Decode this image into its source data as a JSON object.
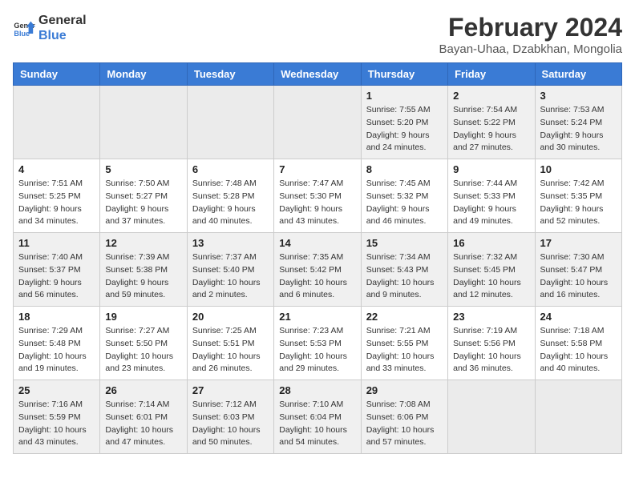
{
  "header": {
    "logo_line1": "General",
    "logo_line2": "Blue",
    "month_year": "February 2024",
    "location": "Bayan-Uhaa, Dzabkhan, Mongolia"
  },
  "weekdays": [
    "Sunday",
    "Monday",
    "Tuesday",
    "Wednesday",
    "Thursday",
    "Friday",
    "Saturday"
  ],
  "weeks": [
    [
      {
        "day": "",
        "info": ""
      },
      {
        "day": "",
        "info": ""
      },
      {
        "day": "",
        "info": ""
      },
      {
        "day": "",
        "info": ""
      },
      {
        "day": "1",
        "info": "Sunrise: 7:55 AM\nSunset: 5:20 PM\nDaylight: 9 hours\nand 24 minutes."
      },
      {
        "day": "2",
        "info": "Sunrise: 7:54 AM\nSunset: 5:22 PM\nDaylight: 9 hours\nand 27 minutes."
      },
      {
        "day": "3",
        "info": "Sunrise: 7:53 AM\nSunset: 5:24 PM\nDaylight: 9 hours\nand 30 minutes."
      }
    ],
    [
      {
        "day": "4",
        "info": "Sunrise: 7:51 AM\nSunset: 5:25 PM\nDaylight: 9 hours\nand 34 minutes."
      },
      {
        "day": "5",
        "info": "Sunrise: 7:50 AM\nSunset: 5:27 PM\nDaylight: 9 hours\nand 37 minutes."
      },
      {
        "day": "6",
        "info": "Sunrise: 7:48 AM\nSunset: 5:28 PM\nDaylight: 9 hours\nand 40 minutes."
      },
      {
        "day": "7",
        "info": "Sunrise: 7:47 AM\nSunset: 5:30 PM\nDaylight: 9 hours\nand 43 minutes."
      },
      {
        "day": "8",
        "info": "Sunrise: 7:45 AM\nSunset: 5:32 PM\nDaylight: 9 hours\nand 46 minutes."
      },
      {
        "day": "9",
        "info": "Sunrise: 7:44 AM\nSunset: 5:33 PM\nDaylight: 9 hours\nand 49 minutes."
      },
      {
        "day": "10",
        "info": "Sunrise: 7:42 AM\nSunset: 5:35 PM\nDaylight: 9 hours\nand 52 minutes."
      }
    ],
    [
      {
        "day": "11",
        "info": "Sunrise: 7:40 AM\nSunset: 5:37 PM\nDaylight: 9 hours\nand 56 minutes."
      },
      {
        "day": "12",
        "info": "Sunrise: 7:39 AM\nSunset: 5:38 PM\nDaylight: 9 hours\nand 59 minutes."
      },
      {
        "day": "13",
        "info": "Sunrise: 7:37 AM\nSunset: 5:40 PM\nDaylight: 10 hours\nand 2 minutes."
      },
      {
        "day": "14",
        "info": "Sunrise: 7:35 AM\nSunset: 5:42 PM\nDaylight: 10 hours\nand 6 minutes."
      },
      {
        "day": "15",
        "info": "Sunrise: 7:34 AM\nSunset: 5:43 PM\nDaylight: 10 hours\nand 9 minutes."
      },
      {
        "day": "16",
        "info": "Sunrise: 7:32 AM\nSunset: 5:45 PM\nDaylight: 10 hours\nand 12 minutes."
      },
      {
        "day": "17",
        "info": "Sunrise: 7:30 AM\nSunset: 5:47 PM\nDaylight: 10 hours\nand 16 minutes."
      }
    ],
    [
      {
        "day": "18",
        "info": "Sunrise: 7:29 AM\nSunset: 5:48 PM\nDaylight: 10 hours\nand 19 minutes."
      },
      {
        "day": "19",
        "info": "Sunrise: 7:27 AM\nSunset: 5:50 PM\nDaylight: 10 hours\nand 23 minutes."
      },
      {
        "day": "20",
        "info": "Sunrise: 7:25 AM\nSunset: 5:51 PM\nDaylight: 10 hours\nand 26 minutes."
      },
      {
        "day": "21",
        "info": "Sunrise: 7:23 AM\nSunset: 5:53 PM\nDaylight: 10 hours\nand 29 minutes."
      },
      {
        "day": "22",
        "info": "Sunrise: 7:21 AM\nSunset: 5:55 PM\nDaylight: 10 hours\nand 33 minutes."
      },
      {
        "day": "23",
        "info": "Sunrise: 7:19 AM\nSunset: 5:56 PM\nDaylight: 10 hours\nand 36 minutes."
      },
      {
        "day": "24",
        "info": "Sunrise: 7:18 AM\nSunset: 5:58 PM\nDaylight: 10 hours\nand 40 minutes."
      }
    ],
    [
      {
        "day": "25",
        "info": "Sunrise: 7:16 AM\nSunset: 5:59 PM\nDaylight: 10 hours\nand 43 minutes."
      },
      {
        "day": "26",
        "info": "Sunrise: 7:14 AM\nSunset: 6:01 PM\nDaylight: 10 hours\nand 47 minutes."
      },
      {
        "day": "27",
        "info": "Sunrise: 7:12 AM\nSunset: 6:03 PM\nDaylight: 10 hours\nand 50 minutes."
      },
      {
        "day": "28",
        "info": "Sunrise: 7:10 AM\nSunset: 6:04 PM\nDaylight: 10 hours\nand 54 minutes."
      },
      {
        "day": "29",
        "info": "Sunrise: 7:08 AM\nSunset: 6:06 PM\nDaylight: 10 hours\nand 57 minutes."
      },
      {
        "day": "",
        "info": ""
      },
      {
        "day": "",
        "info": ""
      }
    ]
  ]
}
